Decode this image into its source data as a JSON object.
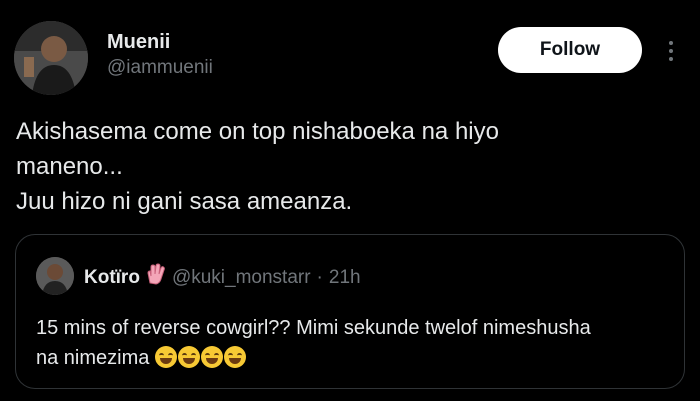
{
  "author": {
    "name": "Muenii",
    "handle": "@iammuenii",
    "avatar_icon": "person-avatar-icon"
  },
  "actions": {
    "follow_label": "Follow",
    "more_icon": "more-vertical-icon"
  },
  "tweet": {
    "lines": [
      "Akishasema come on top nishaboeka na hiyo",
      "maneno...",
      "Juu hizo ni gani sasa ameanza."
    ]
  },
  "quote": {
    "name": "Kotïro",
    "badge_icon": "hand-emoji-icon",
    "handle": "@kuki_monstarr",
    "separator": "·",
    "time": "21h",
    "text_line1": "15 mins of reverse cowgirl?? Mimi sekunde twelof nimeshusha",
    "text_line2": "na nimezima",
    "emoji_icon": "grinning-face-icon",
    "emoji_count": 4
  },
  "colors": {
    "background": "#000000",
    "text": "#e7e9ea",
    "secondary": "#71767b",
    "border": "#2f3336",
    "button_bg": "#ffffff"
  }
}
